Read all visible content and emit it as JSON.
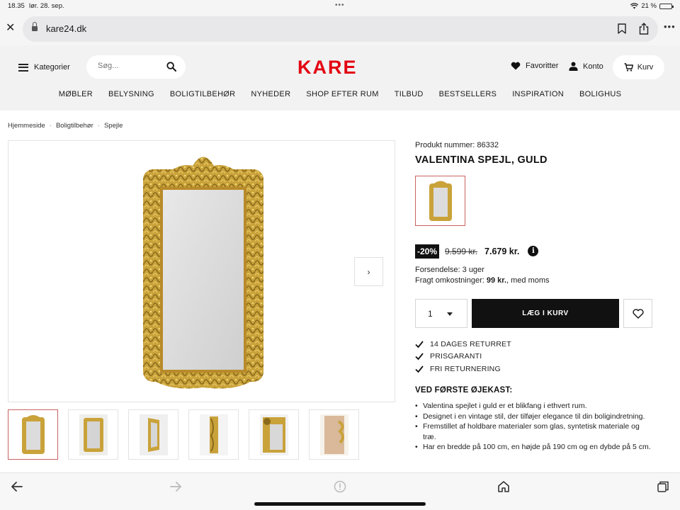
{
  "status_bar": {
    "time": "18.35",
    "date": "lør. 28. sep.",
    "battery_pct": "21 %",
    "battery_level": 0.21
  },
  "browser": {
    "url": "kare24.dk"
  },
  "header": {
    "menu_label": "Kategorier",
    "search_placeholder": "Søg...",
    "logo": "KARE",
    "favorites_label": "Favoritter",
    "account_label": "Konto",
    "cart_label": "Kurv",
    "brand_color": "#e30613"
  },
  "nav": [
    "MØBLER",
    "BELYSNING",
    "BOLIGTILBEHØR",
    "NYHEDER",
    "SHOP EFTER RUM",
    "TILBUD",
    "BESTSELLERS",
    "INSPIRATION",
    "BOLIGHUS"
  ],
  "breadcrumb": [
    "Hjemmeside",
    "Boligtilbehør",
    "Spejle"
  ],
  "product": {
    "number_label": "Produkt nummer: 86332",
    "title": "VALENTINA SPEJL, GULD",
    "discount": "-20%",
    "old_price": "9.599 kr.",
    "new_price": "7.679 kr.",
    "shipping_time": "Forsendelse: 3 uger",
    "shipping_cost_prefix": "Fragt omkostninger: ",
    "shipping_cost_value": "99 kr.",
    "shipping_cost_suffix": ", med moms",
    "quantity": "1",
    "add_to_cart": "LÆG I KURV",
    "benefits": [
      "14 DAGES RETURRET",
      "PRISGARANTI",
      "FRI RETURNERING"
    ],
    "glance_title": "VED FØRSTE ØJEKAST:",
    "glance_items": [
      "Valentina spejlet i guld er et blikfang i ethvert rum.",
      "Designet i en vintage stil, der tilføjer elegance til din boligindretning.",
      "Fremstillet af holdbare materialer som glas, syntetisk materiale og træ.",
      "Har en bredde på 100 cm, en højde på 190 cm og en dybde på 5 cm."
    ]
  },
  "gallery": {
    "thumb_count": 6,
    "active_thumb": 0,
    "frame_color": "#c9a23a",
    "glass_color": "#dcdcdc"
  },
  "icons": [
    "close-icon",
    "lock-icon",
    "bookmark-icon",
    "share-icon",
    "hamburger-icon",
    "search-icon",
    "heart-icon",
    "user-icon",
    "cart-icon",
    "chevron-right-icon",
    "info-icon",
    "check-icon",
    "back-arrow-icon",
    "forward-arrow-icon",
    "shazam-icon",
    "home-icon",
    "tabs-icon"
  ]
}
